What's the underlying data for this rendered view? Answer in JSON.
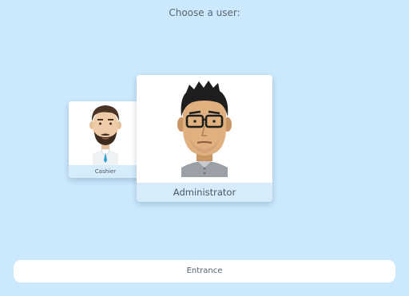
{
  "screen": {
    "heading": "Choose a user:"
  },
  "users": [
    {
      "name": "Cashier",
      "avatar": "cashier-avatar"
    },
    {
      "name": "Administrator",
      "avatar": "administrator-avatar",
      "selected": true
    }
  ],
  "actions": {
    "entrance_label": "Entrance"
  },
  "colors": {
    "background": "#cce8fc",
    "name_bar": "#d7ecfb",
    "text": "#5b6670"
  }
}
